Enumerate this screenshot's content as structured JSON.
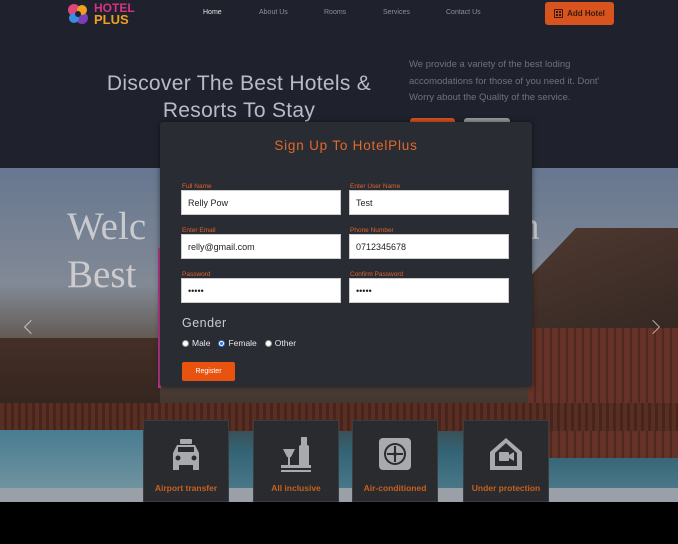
{
  "header": {
    "logo_line1": "HOTEL",
    "logo_line2": "PLUS",
    "nav": [
      "Home",
      "About Us",
      "Rooms",
      "Services",
      "Contact Us"
    ],
    "add_hotel_label": "Add Hotel"
  },
  "hero": {
    "title": "Discover The Best Hotels & Resorts To Stay",
    "description": "We provide a variety of the best loding accomodations for those of you need it. Dont' Worry about the Quality of the service."
  },
  "banner": {
    "welcome_line1": "Welc",
    "welcome_line2": "Best",
    "welcome_tail": "n"
  },
  "modal": {
    "title": "Sign Up To HotelPlus",
    "fields": [
      {
        "label": "Full Name",
        "value": "Relly Pow"
      },
      {
        "label": "Enter User Name",
        "value": "Test"
      },
      {
        "label": "Enter Email",
        "value": "relly@gmail.com"
      },
      {
        "label": "Phone Number",
        "value": "0712345678"
      },
      {
        "label": "Password",
        "value": "•••••"
      },
      {
        "label": "Confirm Password",
        "value": "•••••"
      }
    ],
    "gender_title": "Gender",
    "gender_options": [
      "Male",
      "Female",
      "Other"
    ],
    "gender_selected": "Female",
    "register_label": "Register"
  },
  "features": [
    {
      "label": "Airport transfer",
      "icon": "taxi-icon"
    },
    {
      "label": "All inclusive",
      "icon": "bottle-glass-icon"
    },
    {
      "label": "Air-conditioned",
      "icon": "fan-icon"
    },
    {
      "label": "Under protection",
      "icon": "house-camera-icon"
    }
  ],
  "colors": {
    "accent": "#e06a2a",
    "button": "#e85410",
    "topbar": "#1f222c",
    "modal": "#2a2c34"
  }
}
